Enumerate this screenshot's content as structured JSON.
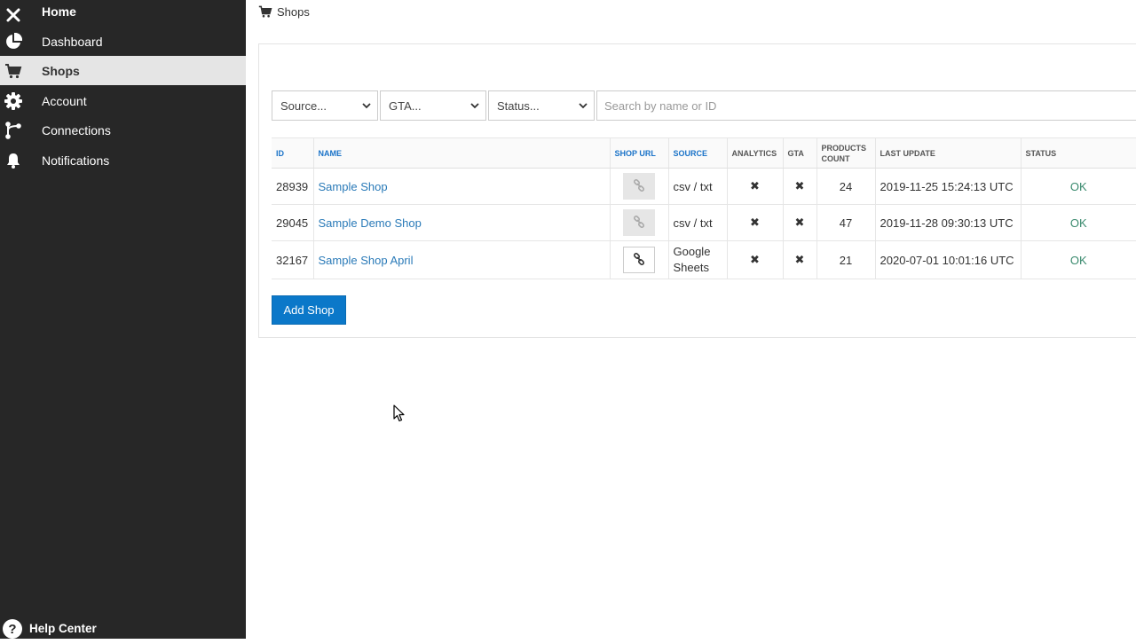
{
  "sidebar": {
    "items": [
      {
        "label": "Home",
        "icon": "close-icon"
      },
      {
        "label": "Dashboard",
        "icon": "pie-chart-icon"
      },
      {
        "label": "Shops",
        "icon": "cart-icon"
      },
      {
        "label": "Account",
        "icon": "gear-icon"
      },
      {
        "label": "Connections",
        "icon": "connections-icon"
      },
      {
        "label": "Notifications",
        "icon": "bell-icon"
      }
    ],
    "active": "Shops",
    "help": {
      "label": "Help Center",
      "icon": "help-icon"
    }
  },
  "breadcrumb": {
    "label": "Shops",
    "icon": "cart-icon"
  },
  "filters": {
    "source": "Source...",
    "gta": "GTA...",
    "status": "Status...",
    "search_placeholder": "Search by name or ID"
  },
  "table": {
    "headers": {
      "id": "ID",
      "name": "NAME",
      "shop_url": "SHOP URL",
      "source": "SOURCE",
      "analytics": "ANALYTICS",
      "gta": "GTA",
      "products_count": "PRODUCTS COUNT",
      "last_update": "LAST UPDATE",
      "status": "STATUS"
    },
    "rows": [
      {
        "id": "28939",
        "name": "Sample Shop",
        "source": "csv / txt",
        "analytics": "✖",
        "gta": "✖",
        "products_count": "24",
        "last_update": "2019-11-25 15:24:13 UTC",
        "status": "OK",
        "url_enabled": false
      },
      {
        "id": "29045",
        "name": "Sample Demo Shop",
        "source": "csv / txt",
        "analytics": "✖",
        "gta": "✖",
        "products_count": "47",
        "last_update": "2019-11-28 09:30:13 UTC",
        "status": "OK",
        "url_enabled": false
      },
      {
        "id": "32167",
        "name": "Sample Shop April",
        "source": "Google Sheets",
        "analytics": "✖",
        "gta": "✖",
        "products_count": "21",
        "last_update": "2020-07-01 10:01:16 UTC",
        "status": "OK",
        "url_enabled": true
      }
    ]
  },
  "add_shop_label": "Add Shop",
  "colors": {
    "sidebar_bg": "#272727",
    "active_bg": "#e5e5e5",
    "link": "#2a7ab8",
    "primary_button": "#0b78c9",
    "status_ok": "#3a8a6e"
  }
}
